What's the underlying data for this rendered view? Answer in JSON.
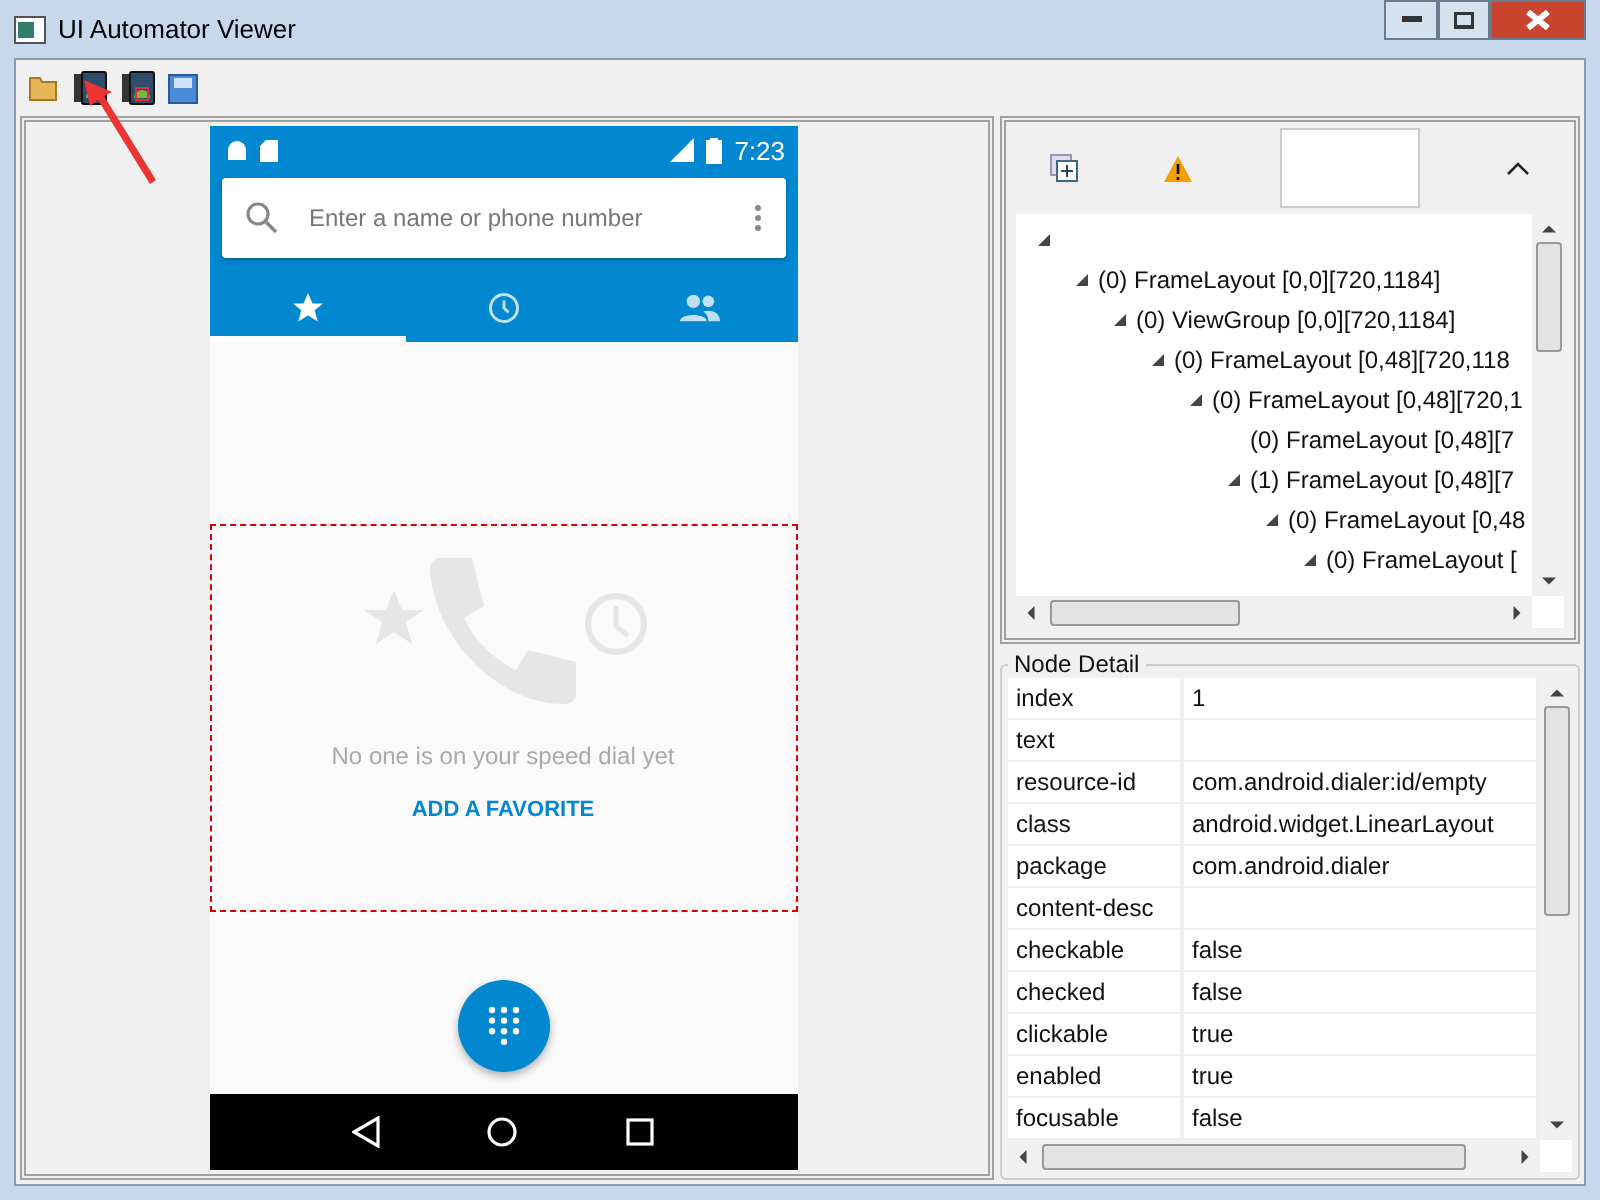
{
  "window": {
    "title": "UI Automator Viewer"
  },
  "toolbar": [
    {
      "kind": "open"
    },
    {
      "kind": "screenshot"
    },
    {
      "kind": "screenshot-alt"
    },
    {
      "kind": "save"
    }
  ],
  "device": {
    "time": "7:23",
    "search": {
      "placeholder": "Enter a name or phone number"
    },
    "tabs": [
      {
        "kind": "star",
        "selected": true
      },
      {
        "kind": "clock",
        "selected": false
      },
      {
        "kind": "people",
        "selected": false
      }
    ],
    "empty_message": "No one is on your speed dial yet",
    "link": "ADD A FAVORITE",
    "selection_highlighted": true
  },
  "tree": {
    "nodes": [
      {
        "expanded": true,
        "children": [
          {
            "label": "(0) FrameLayout [0,0][720,1184]",
            "expanded": true,
            "children": [
              {
                "label": "(0) ViewGroup [0,0][720,1184]",
                "expanded": true,
                "children": [
                  {
                    "label": "(0) FrameLayout [0,48][720,118",
                    "expanded": true,
                    "children": [
                      {
                        "label": "(0) FrameLayout [0,48][720,1",
                        "expanded": true,
                        "children": [
                          {
                            "label": "(0) FrameLayout [0,48][7",
                            "expanded": false
                          },
                          {
                            "label": "(1) FrameLayout [0,48][7",
                            "expanded": true,
                            "children": [
                              {
                                "label": "(0) FrameLayout [0,48",
                                "expanded": true,
                                "children": [
                                  {
                                    "label": "(0) FrameLayout [",
                                    "expanded": true
                                  }
                                ]
                              }
                            ]
                          }
                        ]
                      }
                    ]
                  }
                ]
              }
            ]
          }
        ]
      }
    ]
  },
  "node_detail": {
    "title": "Node Detail",
    "rows": [
      {
        "name": "index",
        "value": "1"
      },
      {
        "name": "text"
      },
      {
        "name": "resource-id",
        "value": "com.android.dialer:id/empty"
      },
      {
        "name": "class",
        "value": "android.widget.LinearLayout"
      },
      {
        "name": "package",
        "value": "com.android.dialer"
      },
      {
        "name": "content-desc"
      },
      {
        "name": "checkable",
        "value": "false"
      },
      {
        "name": "checked",
        "value": "false"
      },
      {
        "name": "clickable",
        "value": "true"
      },
      {
        "name": "enabled",
        "value": "true"
      },
      {
        "name": "focusable",
        "value": "false"
      }
    ]
  }
}
